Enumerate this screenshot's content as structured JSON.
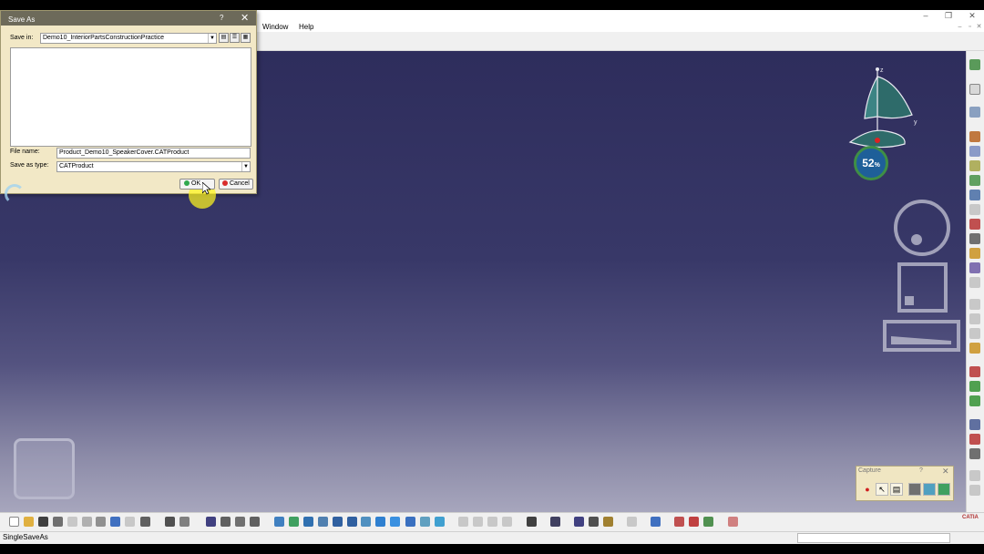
{
  "window": {
    "menu": [
      "Window",
      "Help"
    ],
    "controls": {
      "minimize": "–",
      "restore": "❐",
      "close": "✕"
    },
    "mdi_controls": {
      "minimize": "–",
      "restore": "▫",
      "close": "✕"
    }
  },
  "save_as_dialog": {
    "title": "Save As",
    "help_glyph": "?",
    "close_glyph": "✕",
    "save_in_label": "Save in:",
    "save_in_value": "Demo10_InteriorPartsConstructionPractice",
    "file_name_label": "File name:",
    "file_name_value": "Product_Demo10_SpeakerCover.CATProduct",
    "save_as_type_label": "Save as type:",
    "save_as_type_value": "CATProduct",
    "ok_label": "OK",
    "cancel_label": "Cancel"
  },
  "compass": {
    "z_label": "z",
    "y_label": "y",
    "zoom_value": "52",
    "zoom_unit": "%"
  },
  "capture_toolbar": {
    "title": "Capture",
    "help_glyph": "?",
    "close_glyph": "✕"
  },
  "status_bar": {
    "command": "SingleSaveAs"
  },
  "colors": {
    "viewport_top": "#2e2d5c",
    "viewport_bottom": "#a7a6bd",
    "dialog_bg": "#f2e8c6",
    "ok_dot": "#2fa84f",
    "cancel_dot": "#d92c2c",
    "cursor_halo": "#fff51e"
  }
}
